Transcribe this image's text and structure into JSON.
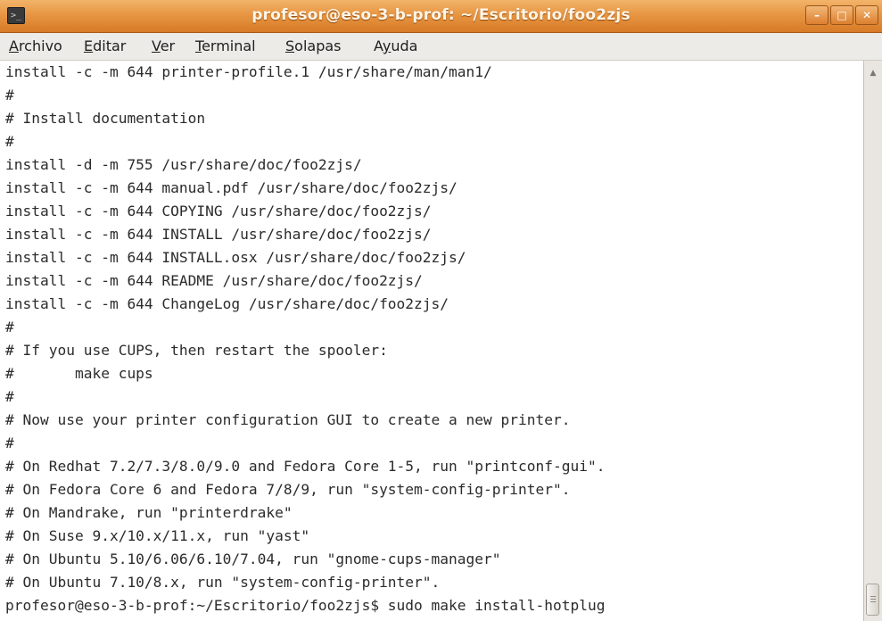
{
  "window": {
    "title": "profesor@eso-3-b-prof: ~/Escritorio/foo2zjs",
    "app_icon": "terminal-icon",
    "buttons": {
      "minimize": "minimize-icon",
      "maximize": "maximize-icon",
      "close": "close-icon"
    },
    "colors": {
      "titlebar": "#e08a35",
      "terminal_bg": "#ffffff",
      "terminal_fg": "#2b2b2b"
    }
  },
  "menu": {
    "items": [
      {
        "pre": "",
        "key": "A",
        "post": "rchivo"
      },
      {
        "pre": "",
        "key": "E",
        "post": "ditar"
      },
      {
        "pre": "",
        "key": "V",
        "post": "er"
      },
      {
        "pre": "",
        "key": "T",
        "post": "erminal"
      },
      {
        "pre": "",
        "key": "S",
        "post": "olapas"
      },
      {
        "pre": "A",
        "key": "y",
        "post": "uda"
      }
    ]
  },
  "terminal": {
    "lines": [
      "install -c -m 644 printer-profile.1 /usr/share/man/man1/",
      "#",
      "# Install documentation",
      "#",
      "install -d -m 755 /usr/share/doc/foo2zjs/",
      "install -c -m 644 manual.pdf /usr/share/doc/foo2zjs/",
      "install -c -m 644 COPYING /usr/share/doc/foo2zjs/",
      "install -c -m 644 INSTALL /usr/share/doc/foo2zjs/",
      "install -c -m 644 INSTALL.osx /usr/share/doc/foo2zjs/",
      "install -c -m 644 README /usr/share/doc/foo2zjs/",
      "install -c -m 644 ChangeLog /usr/share/doc/foo2zjs/",
      "#",
      "# If you use CUPS, then restart the spooler:",
      "#       make cups",
      "#",
      "# Now use your printer configuration GUI to create a new printer.",
      "#",
      "# On Redhat 7.2/7.3/8.0/9.0 and Fedora Core 1-5, run \"printconf-gui\".",
      "# On Fedora Core 6 and Fedora 7/8/9, run \"system-config-printer\".",
      "# On Mandrake, run \"printerdrake\"",
      "# On Suse 9.x/10.x/11.x, run \"yast\"",
      "# On Ubuntu 5.10/6.06/6.10/7.04, run \"gnome-cups-manager\"",
      "# On Ubuntu 7.10/8.x, run \"system-config-printer\".",
      "profesor@eso-3-b-prof:~/Escritorio/foo2zjs$ sudo make install-hotplug"
    ]
  }
}
